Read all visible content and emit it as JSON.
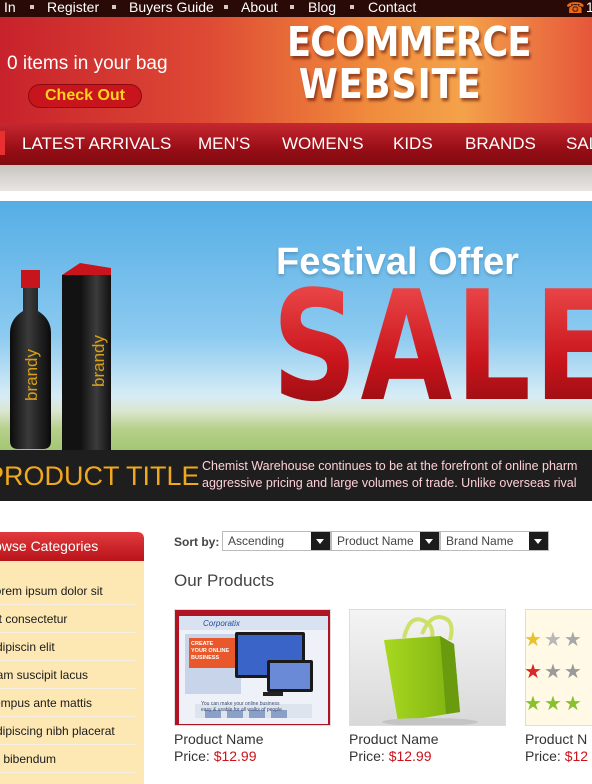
{
  "top_links": [
    "In",
    "Register",
    "Buyers Guide",
    "About",
    "Blog",
    "Contact"
  ],
  "phone_partial": "1",
  "header": {
    "bag_text": "0 items in your bag",
    "checkout_label": "Check Out",
    "logo_line1": "ECOMMERCE",
    "logo_line2": "WEBSITE"
  },
  "nav": [
    "LATEST ARRIVALS",
    "MEN'S",
    "WOMEN'S",
    "KIDS",
    "BRANDS",
    "SAL"
  ],
  "banner": {
    "festival": "Festival Offer",
    "sale": "SALE",
    "bottle_label": "brandy",
    "box_label": "brandy",
    "product_title": "PRODUCT TITLE",
    "desc_line1": "Chemist Warehouse continues to be at the forefront of online pharm",
    "desc_line2": "aggressive pricing and large volumes of trade. Unlike overseas rival"
  },
  "sidebar": {
    "heading": "Browse Categories",
    "items": [
      "Lorem ipsum dolor sit",
      "Sit consectetur",
      "Adipiscin elit",
      "Nam suscipit lacus",
      "Tempus ante mattis",
      "Adipiscing nibh placerat",
      "Ut bibendum"
    ]
  },
  "sort": {
    "label": "Sort by:",
    "options": [
      "Ascending",
      "Product Name",
      "Brand Name"
    ]
  },
  "products_heading": "Our Products",
  "products": [
    {
      "name": "Product Name",
      "price_label": "Price:",
      "price": "$12.99",
      "thumb": "corporatix-screens"
    },
    {
      "name": "Product Name",
      "price_label": "Price:",
      "price": "$12.99",
      "thumb": "green-bag"
    },
    {
      "name": "Product N",
      "price_label": "Price:",
      "price": "$12",
      "thumb": "stars"
    }
  ],
  "thumb_text": {
    "site_title": "Corporatix",
    "screen_line1": "CREATE",
    "screen_line2": "YOUR ONLINE",
    "screen_line3": "BUSINESS",
    "promo_line1": "You can make your online business",
    "promo_line2": "easy & usable for all walks of people"
  },
  "colors": {
    "nav_red": "#9a0e16",
    "price_red": "#c8141c",
    "checkout_yellow": "#ffd21c",
    "title_orange": "#f0a81e"
  }
}
